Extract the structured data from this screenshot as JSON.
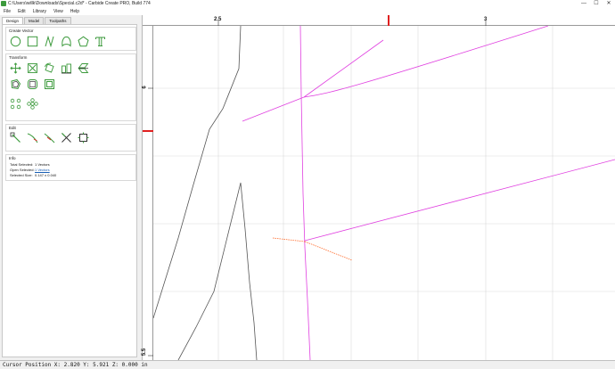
{
  "window": {
    "title": "C:\\Users\\willk\\Downloads\\Special.c2d* - Carbide Create PRO, Build 774",
    "minimize": "—",
    "maximize": "☐",
    "close": "✕"
  },
  "menu": [
    "File",
    "Edit",
    "Library",
    "View",
    "Help"
  ],
  "tabs": [
    "Design",
    "Model",
    "Toolpaths"
  ],
  "sections": {
    "create_vector": "Create Vector",
    "transform": "Transform",
    "edit": "Edit",
    "info": "Info"
  },
  "info": {
    "total_selected_label": "Total Selected:",
    "total_selected_value": "1 Vectors",
    "open_selected_label": "Open Selected:",
    "open_selected_value": "1 Vectors",
    "selected_size_label": "Selected Size:",
    "selected_size_value": "0.147 x 0.040"
  },
  "rulers": {
    "h_labels": [
      "2.5",
      "3"
    ],
    "v_labels": [
      "6",
      "5.5"
    ]
  },
  "colors": {
    "tool_green": "#3c9a3c",
    "accent_red": "#e02020",
    "vector_magenta": "#e040e0",
    "selected_orange": "#ff6a2a",
    "grid": "#d9d9d9",
    "vector_gray": "#555555"
  },
  "status": {
    "text": "Cursor Position X: 2.820 Y: 5.921 Z: 0.000 in"
  }
}
